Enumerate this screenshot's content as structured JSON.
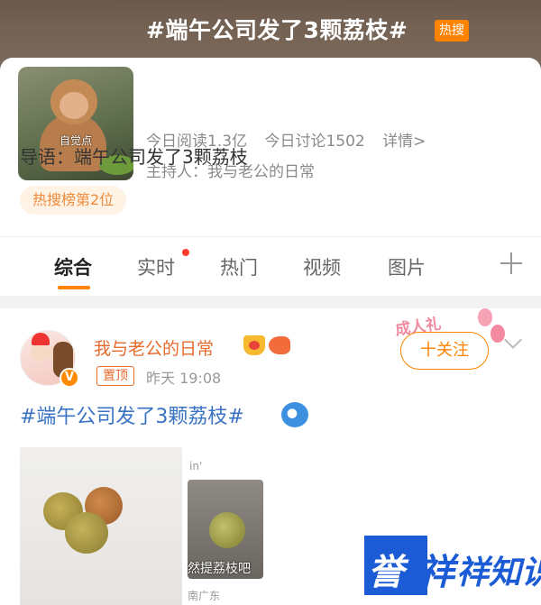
{
  "topic": {
    "title": "#端午公司发了3颗荔枝#",
    "badge": "热搜",
    "avatar_caption": "自觉点",
    "stats": {
      "reads": "今日阅读1.3亿",
      "discussions": "今日讨论1502",
      "details": "详情>"
    },
    "host": "主持人：我与老公的日常",
    "intro": "导语：端午公司发了3颗荔枝",
    "rank": "热搜榜第2位"
  },
  "tabs": [
    {
      "label": "综合",
      "active": true
    },
    {
      "label": "实时",
      "active": false,
      "has_dot": true
    },
    {
      "label": "热门",
      "active": false
    },
    {
      "label": "视频",
      "active": false
    },
    {
      "label": "图片",
      "active": false
    }
  ],
  "post": {
    "author": "我与老公的日常",
    "pinned": "置顶",
    "time": "昨天 19:08",
    "follow_label": "十关注",
    "decoration_text": "成人礼",
    "verify_mark": "V",
    "text": "#端午公司发了3颗荔枝#",
    "image_2_caption": "然提荔枝吧",
    "image_2_top": "in'",
    "location": "南广东"
  },
  "watermark": {
    "char1": "誉",
    "char2": "祥",
    "rest": "祥知识"
  },
  "colors": {
    "accent": "#ff8200",
    "link": "#3a72c4",
    "author": "#e86a2d",
    "watermark": "#1c5bd6"
  }
}
